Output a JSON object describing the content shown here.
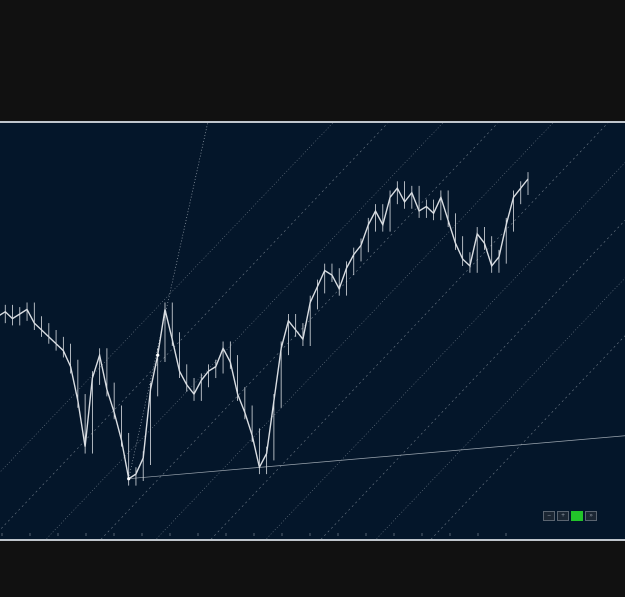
{
  "colors": {
    "frame_bg": "#111111",
    "plot_bg": "#04162a",
    "price": "#d9dde2",
    "fan_line": "#9aa4ae",
    "border": "#bfc5cc",
    "active_button": "#22c42a"
  },
  "nav_buttons": [
    {
      "name": "zoom-out-button",
      "icon": "minus-icon",
      "active": false
    },
    {
      "name": "zoom-in-button",
      "icon": "plus-icon",
      "active": false
    },
    {
      "name": "chart-mode-button",
      "icon": "green-square-icon",
      "active": true
    },
    {
      "name": "scroll-end-button",
      "icon": "arrow-icon",
      "active": false
    }
  ],
  "chart_data": {
    "type": "line",
    "title": "",
    "xlabel": "",
    "ylabel": "",
    "x_ticks": [
      "",
      "",
      "",
      "",
      "",
      "",
      "",
      "",
      "",
      "",
      "",
      "",
      "",
      "",
      "",
      "",
      "",
      "",
      ""
    ],
    "ylim": [
      0,
      100
    ],
    "grid": false,
    "legend": "none",
    "series": [
      {
        "values": [
          72,
          74,
          71,
          73,
          75,
          69,
          66,
          63,
          60,
          57,
          50,
          35,
          15,
          45,
          55,
          40,
          30,
          18,
          1,
          3,
          10,
          40,
          55,
          75,
          62,
          48,
          42,
          38,
          44,
          48,
          50,
          58,
          52,
          38,
          30,
          20,
          6,
          12,
          35,
          58,
          70,
          66,
          62,
          78,
          85,
          92,
          90,
          84,
          93,
          99,
          103,
          112,
          118,
          112,
          124,
          128,
          122,
          126,
          118,
          120,
          117,
          124,
          114,
          104,
          97,
          94,
          108,
          104,
          94,
          98,
          112,
          124,
          128,
          132
        ]
      }
    ],
    "overlay": {
      "type": "gann_fan",
      "pivot_index": 18,
      "high_index": 22,
      "lines": 10
    }
  }
}
